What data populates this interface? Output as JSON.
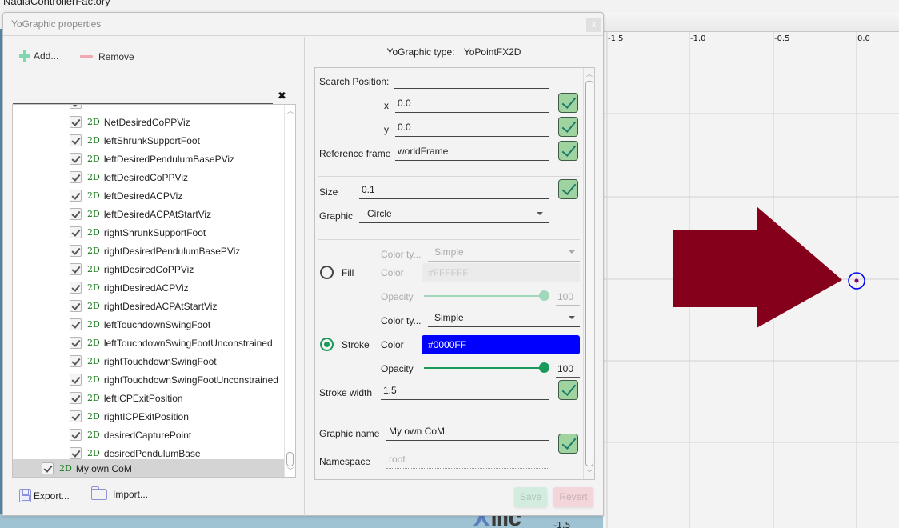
{
  "app": {
    "title": "NadiaControllerFactory"
  },
  "dialog": {
    "title": "YoGraphic properties",
    "close_label": "x",
    "left": {
      "add_label": "Add...",
      "remove_label": "Remove",
      "search_value": "",
      "clear_search_label": "✖",
      "badge": "2D",
      "items": [
        {
          "label": "NetDesiredCoPPViz",
          "checked": true
        },
        {
          "label": "leftShrunkSupportFoot",
          "checked": true
        },
        {
          "label": "leftDesiredPendulumBasePViz",
          "checked": true
        },
        {
          "label": "leftDesiredCoPPViz",
          "checked": true
        },
        {
          "label": "leftDesiredACPViz",
          "checked": true
        },
        {
          "label": "leftDesiredACPAtStartViz",
          "checked": true
        },
        {
          "label": "rightShrunkSupportFoot",
          "checked": true
        },
        {
          "label": "rightDesiredPendulumBasePViz",
          "checked": true
        },
        {
          "label": "rightDesiredCoPPViz",
          "checked": true
        },
        {
          "label": "rightDesiredACPViz",
          "checked": true
        },
        {
          "label": "rightDesiredACPAtStartViz",
          "checked": true
        },
        {
          "label": "leftTouchdownSwingFoot",
          "checked": true
        },
        {
          "label": "leftTouchdownSwingFootUnconstrained",
          "checked": true
        },
        {
          "label": "rightTouchdownSwingFoot",
          "checked": true
        },
        {
          "label": "rightTouchdownSwingFootUnconstrained",
          "checked": true
        },
        {
          "label": "leftICPExitPosition",
          "checked": true
        },
        {
          "label": "rightICPExitPosition",
          "checked": true
        },
        {
          "label": "desiredCapturePoint",
          "checked": true
        },
        {
          "label": "desiredPendulumBase",
          "checked": true
        }
      ],
      "selected_item": {
        "label": "My own CoM",
        "checked": true
      },
      "export_label": "Export...",
      "import_label": "Import..."
    },
    "right": {
      "type_label": "YoGraphic type:",
      "type_value": "YoPointFX2D",
      "search_position_label": "Search Position:",
      "search_position_value": "",
      "x_label": "x",
      "x_value": "0.0",
      "y_label": "y",
      "y_value": "0.0",
      "reference_frame_label": "Reference frame",
      "reference_frame_value": "worldFrame",
      "size_label": "Size",
      "size_value": "0.1",
      "graphic_label": "Graphic",
      "graphic_value": "Circle",
      "fill": {
        "label": "Fill",
        "selected": false,
        "color_type_label": "Color ty...",
        "color_type_value": "Simple",
        "color_label": "Color",
        "color_value": "#FFFFFF",
        "opacity_label": "Opacity",
        "opacity_value": "100",
        "opacity_fraction": 1.0
      },
      "stroke": {
        "label": "Stroke",
        "selected": true,
        "color_type_label": "Color ty...",
        "color_type_value": "Simple",
        "color_label": "Color",
        "color_value": "#0000FF",
        "opacity_label": "Opacity",
        "opacity_value": "100",
        "opacity_fraction": 1.0
      },
      "stroke_width_label": "Stroke width",
      "stroke_width_value": "1.5",
      "graphic_name_label": "Graphic name",
      "graphic_name_value": "My own CoM",
      "namespace_label": "Namespace",
      "namespace_value": "root",
      "save_label": "Save",
      "revert_label": "Revert"
    }
  },
  "plot": {
    "x_ticks": [
      "-1.5",
      "-1.0",
      "-0.5",
      "0.0"
    ],
    "bottom_tick": "-1.5",
    "arrow_color": "#85001a",
    "point_stroke_color": "#0000FF",
    "point_center_color": "#85006b"
  },
  "colors": {
    "accent_green": "#1a9a5a",
    "ok_green": "#9fd4a1"
  }
}
